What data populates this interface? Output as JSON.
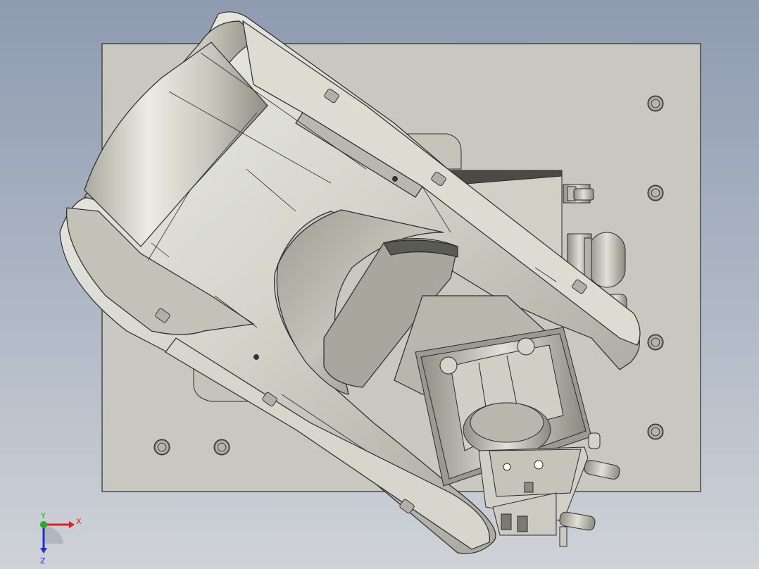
{
  "viewport": {
    "background_top": "#8e9bb0",
    "background_bottom": "#cfd3d8"
  },
  "model": {
    "plate_color": "#c8c8c0",
    "body_color": "#d2d2c8",
    "edge_color": "#2b2b2b",
    "cable_color": "#4a4a46"
  },
  "triad": {
    "x_label": "X",
    "y_label": "Y",
    "z_label": "Z",
    "x_color": "#e02020",
    "y_color": "#20b020",
    "z_color": "#2030d0"
  }
}
